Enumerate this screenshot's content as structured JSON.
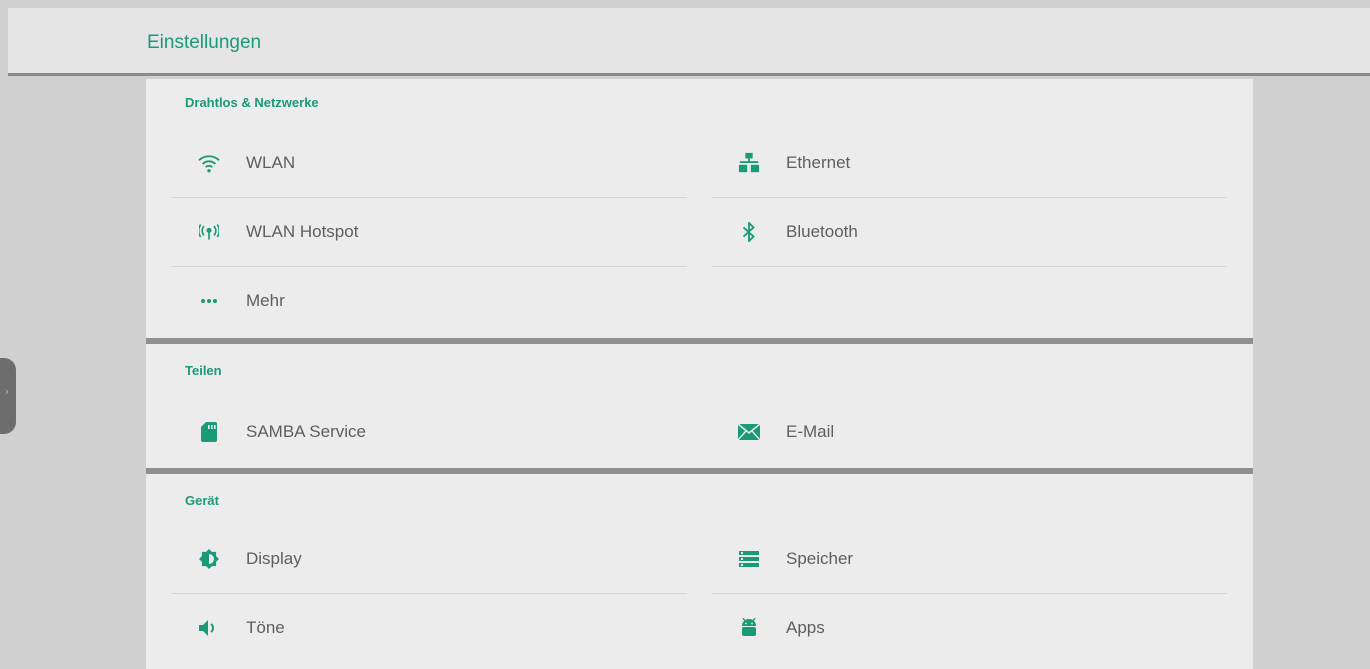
{
  "header": {
    "title": "Einstellungen"
  },
  "colors": {
    "accent": "#1a9a77",
    "text": "#5e5e5e",
    "panel": "#ececec"
  },
  "sections": [
    {
      "title": "Drahtlos & Netzwerke",
      "items": [
        {
          "label": "WLAN",
          "icon": "wifi-icon"
        },
        {
          "label": "Ethernet",
          "icon": "ethernet-icon"
        },
        {
          "label": "WLAN Hotspot",
          "icon": "hotspot-icon"
        },
        {
          "label": "Bluetooth",
          "icon": "bluetooth-icon"
        },
        {
          "label": "Mehr",
          "icon": "more-dots-icon"
        }
      ]
    },
    {
      "title": "Teilen",
      "items": [
        {
          "label": "SAMBA Service",
          "icon": "sd-card-icon"
        },
        {
          "label": "E-Mail",
          "icon": "email-icon"
        }
      ]
    },
    {
      "title": "Gerät",
      "items": [
        {
          "label": "Display",
          "icon": "brightness-icon"
        },
        {
          "label": "Speicher",
          "icon": "storage-icon"
        },
        {
          "label": "Töne",
          "icon": "volume-icon"
        },
        {
          "label": "Apps",
          "icon": "android-icon"
        }
      ]
    }
  ]
}
